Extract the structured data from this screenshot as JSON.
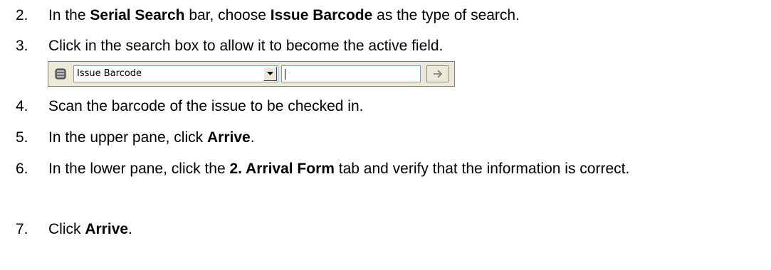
{
  "steps": [
    {
      "number": "2.",
      "parts": [
        {
          "text": "In the ",
          "bold": false
        },
        {
          "text": "Serial Search",
          "bold": true
        },
        {
          "text": " bar, choose ",
          "bold": false
        },
        {
          "text": "Issue Barcode",
          "bold": true
        },
        {
          "text": " as the type of search.",
          "bold": false
        }
      ]
    },
    {
      "number": "3.",
      "parts": [
        {
          "text": "Click in the search box to allow it to become the active field.",
          "bold": false
        }
      ]
    },
    {
      "number": "4.",
      "parts": [
        {
          "text": "Scan the barcode of the issue to be checked in.",
          "bold": false
        }
      ]
    },
    {
      "number": "5.",
      "parts": [
        {
          "text": "In the upper pane, click ",
          "bold": false
        },
        {
          "text": "Arrive",
          "bold": true
        },
        {
          "text": ".",
          "bold": false
        }
      ]
    },
    {
      "number": "6.",
      "parts": [
        {
          "text": "In the lower pane, click the ",
          "bold": false
        },
        {
          "text": "2. Arrival Form",
          "bold": true
        },
        {
          "text": " tab and verify that the information is correct.",
          "bold": false
        }
      ]
    },
    {
      "number": "7.",
      "parts": [
        {
          "text": "Click ",
          "bold": false
        },
        {
          "text": "Arrive",
          "bold": true
        },
        {
          "text": ".",
          "bold": false
        }
      ]
    }
  ],
  "serial_search_bar": {
    "search_type_value": "Issue Barcode",
    "search_input_value": "",
    "icons": {
      "bar": "serial-icon",
      "dropdown": "chevron-down-icon",
      "go": "arrow-right-icon"
    }
  }
}
